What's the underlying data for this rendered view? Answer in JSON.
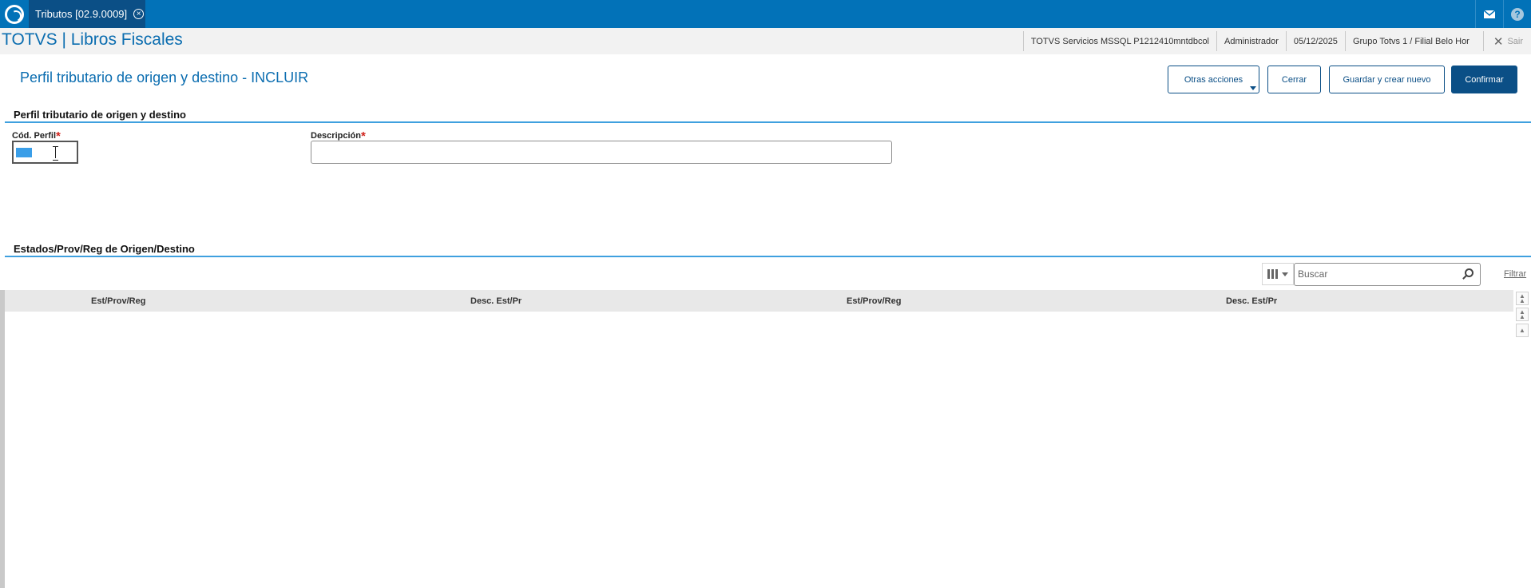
{
  "topbar": {
    "tab_label": "Tributos [02.9.0009]",
    "icons": [
      "app-logo-icon",
      "close-icon",
      "mail-icon",
      "help-icon"
    ],
    "help_glyph": "?",
    "accent_color": "#0272b8"
  },
  "infobar": {
    "app_title": "TOTVS | Libros Fiscales",
    "environment": "TOTVS Servicios MSSQL P1212410mntdbcol",
    "user": "Administrador",
    "date": "05/12/2025",
    "branch": "Grupo Totvs 1 / Filial Belo Hor",
    "exit_label": "Sair"
  },
  "page": {
    "title": "Perfil tributario de origen y destino - INCLUIR"
  },
  "actions": {
    "more_label": "Otras acciones",
    "close_label": "Cerrar",
    "save_new_label": "Guardar y crear nuevo",
    "confirm_label": "Confirmar"
  },
  "form": {
    "section_title": "Perfil tributario de origen y destino",
    "code_label": "Cód. Perfil",
    "code_value": "",
    "description_label": "Descripción",
    "description_value": "",
    "required_mark": "*"
  },
  "grid": {
    "section_title": "Estados/Prov/Reg de Origen/Destino",
    "search_placeholder": "Buscar",
    "filter_label": "Filtrar",
    "columns": [
      "Est/Prov/Reg",
      "Desc. Est/Pr",
      "Est/Prov/Reg",
      "Desc. Est/Pr"
    ],
    "rows": []
  }
}
